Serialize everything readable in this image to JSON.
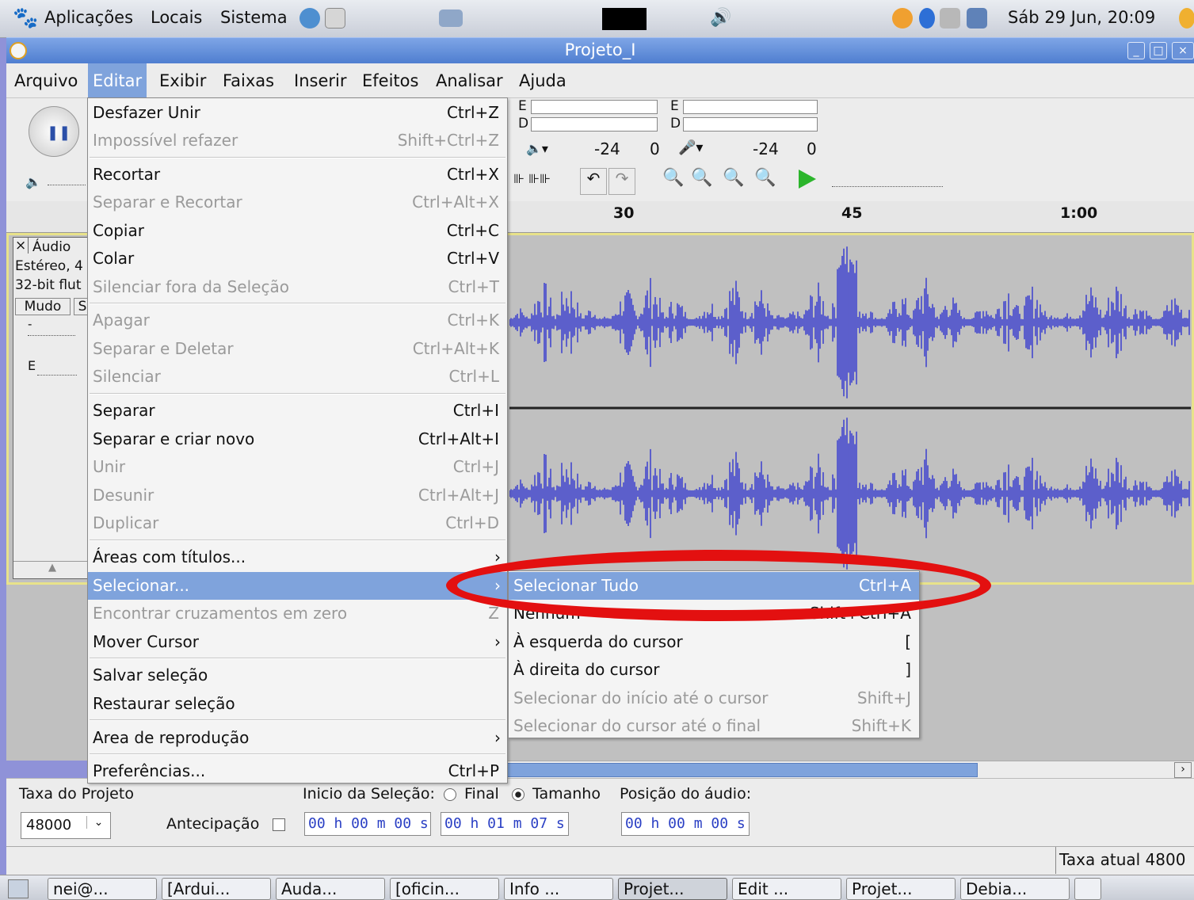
{
  "top_panel": {
    "applications": "Aplicações",
    "places": "Locais",
    "system": "Sistema",
    "clock": "Sáb 29 Jun, 20:09"
  },
  "window": {
    "title": "Projeto_I"
  },
  "menubar": [
    "Arquivo",
    "Editar",
    "Exibir",
    "Faixas",
    "Inserir",
    "Efeitos",
    "Analisar",
    "Ajuda"
  ],
  "toolbar": {
    "meter_left_e": "E",
    "meter_left_d": "D",
    "meter_right_e": "E",
    "meter_right_d": "D",
    "db_1": "-24",
    "zero_1": "0",
    "db_2": "-24",
    "zero_2": "0"
  },
  "ruler": {
    "t30": "30",
    "t45": "45",
    "t100": "1:00"
  },
  "track": {
    "close": "×",
    "name": "Áudio",
    "line1": "Estéreo, 4",
    "line2": "32-bit flut",
    "mute": "Mudo",
    "solo": "S",
    "gain_label": "-",
    "pan_label": "E"
  },
  "edit_menu": {
    "items": [
      {
        "label": "Desfazer Unir",
        "shortcut": "Ctrl+Z",
        "disabled": false
      },
      {
        "label": "Impossível refazer",
        "shortcut": "Shift+Ctrl+Z",
        "disabled": true
      },
      {
        "label": "Recortar",
        "shortcut": "Ctrl+X",
        "disabled": false
      },
      {
        "label": "Separar e Recortar",
        "shortcut": "Ctrl+Alt+X",
        "disabled": true
      },
      {
        "label": "Copiar",
        "shortcut": "Ctrl+C",
        "disabled": false
      },
      {
        "label": "Colar",
        "shortcut": "Ctrl+V",
        "disabled": false
      },
      {
        "label": "Silenciar fora da Seleção",
        "shortcut": "Ctrl+T",
        "disabled": true
      },
      {
        "label": "Apagar",
        "shortcut": "Ctrl+K",
        "disabled": true
      },
      {
        "label": "Separar e Deletar",
        "shortcut": "Ctrl+Alt+K",
        "disabled": true
      },
      {
        "label": "Silenciar",
        "shortcut": "Ctrl+L",
        "disabled": true
      },
      {
        "label": "Separar",
        "shortcut": "Ctrl+I",
        "disabled": false
      },
      {
        "label": "Separar e criar novo",
        "shortcut": "Ctrl+Alt+I",
        "disabled": false
      },
      {
        "label": "Unir",
        "shortcut": "Ctrl+J",
        "disabled": true
      },
      {
        "label": "Desunir",
        "shortcut": "Ctrl+Alt+J",
        "disabled": true
      },
      {
        "label": "Duplicar",
        "shortcut": "Ctrl+D",
        "disabled": true
      },
      {
        "label": "Áreas com títulos...",
        "shortcut": "",
        "disabled": false
      },
      {
        "label": "Selecionar...",
        "shortcut": "",
        "disabled": false
      },
      {
        "label": "Encontrar cruzamentos em zero",
        "shortcut": "Z",
        "disabled": true
      },
      {
        "label": "Mover Cursor",
        "shortcut": "",
        "disabled": false
      },
      {
        "label": "Salvar seleção",
        "shortcut": "",
        "disabled": false
      },
      {
        "label": "Restaurar seleção",
        "shortcut": "",
        "disabled": false
      },
      {
        "label": "Area de reprodução",
        "shortcut": "",
        "disabled": false
      },
      {
        "label": "Preferências...",
        "shortcut": "Ctrl+P",
        "disabled": false
      }
    ]
  },
  "select_submenu": {
    "items": [
      {
        "label": "Selecionar Tudo",
        "shortcut": "Ctrl+A",
        "disabled": false
      },
      {
        "label": "Nenhum",
        "shortcut": "Shift+Ctrl+A",
        "disabled": false
      },
      {
        "label": "À esquerda do cursor",
        "shortcut": "[",
        "disabled": false
      },
      {
        "label": "À direita do cursor",
        "shortcut": "]",
        "disabled": false
      },
      {
        "label": "Selecionar do início até o cursor",
        "shortcut": "Shift+J",
        "disabled": true
      },
      {
        "label": "Selecionar do cursor até o final",
        "shortcut": "Shift+K",
        "disabled": true
      }
    ]
  },
  "bottom_toolbar": {
    "project_rate_label": "Taxa do Projeto",
    "project_rate": "48000",
    "snap_label": "Antecipação",
    "selection_start_label": "Inicio da Seleção:",
    "end_label": "Final",
    "length_label": "Tamanho",
    "audio_position_label": "Posição do áudio:",
    "sel_start": "00 h 00 m 00 s",
    "sel_length": "00 h 01 m 07 s",
    "audio_pos": "00 h 00 m 00 s"
  },
  "status": {
    "rate": "Taxa atual 4800"
  },
  "taskbar": [
    "nei@...",
    "[Ardui...",
    "Auda...",
    "[oficin...",
    "Info ...",
    "Projet...",
    "Edit ...",
    "Projet...",
    "Debia..."
  ],
  "colors": {
    "accent": "#7fa3dc",
    "waveform": "#3b3fcf",
    "highlight_ring": "#e31010"
  }
}
